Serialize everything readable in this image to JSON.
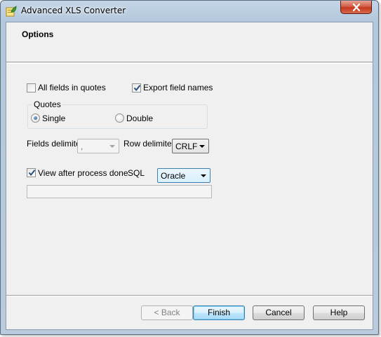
{
  "window": {
    "title": "Advanced XLS Converter"
  },
  "header": {
    "title": "Options"
  },
  "options": {
    "all_fields_in_quotes": {
      "label": "All fields in quotes",
      "checked": false
    },
    "export_field_names": {
      "label": "Export field names",
      "checked": true
    },
    "quotes": {
      "title": "Quotes",
      "single_label": "Single",
      "double_label": "Double",
      "selected": "Single"
    },
    "fields_delimiter": {
      "label": "Fields delimiter",
      "value": ","
    },
    "row_delimiter": {
      "label": "Row delimiter",
      "value": "CRLF"
    },
    "view_after_process": {
      "label": "View after process done",
      "checked": true
    },
    "sql": {
      "label": "SQL",
      "value": "Oracle"
    },
    "viewer_path": {
      "value": ""
    }
  },
  "buttons": {
    "back": "< Back",
    "finish": "Finish",
    "cancel": "Cancel",
    "help": "Help"
  },
  "icons": {
    "app": "spreadsheet-leaf-icon",
    "close": "close-icon",
    "checkmark": "checkmark-icon",
    "dropdown": "chevron-down-icon"
  },
  "colors": {
    "title_bar": "#b9cbdd",
    "close_button": "#c4391e",
    "dialog_background": "#f0f0f0",
    "default_button": "#bee6fd",
    "check_mark": "#2a4e7a"
  }
}
